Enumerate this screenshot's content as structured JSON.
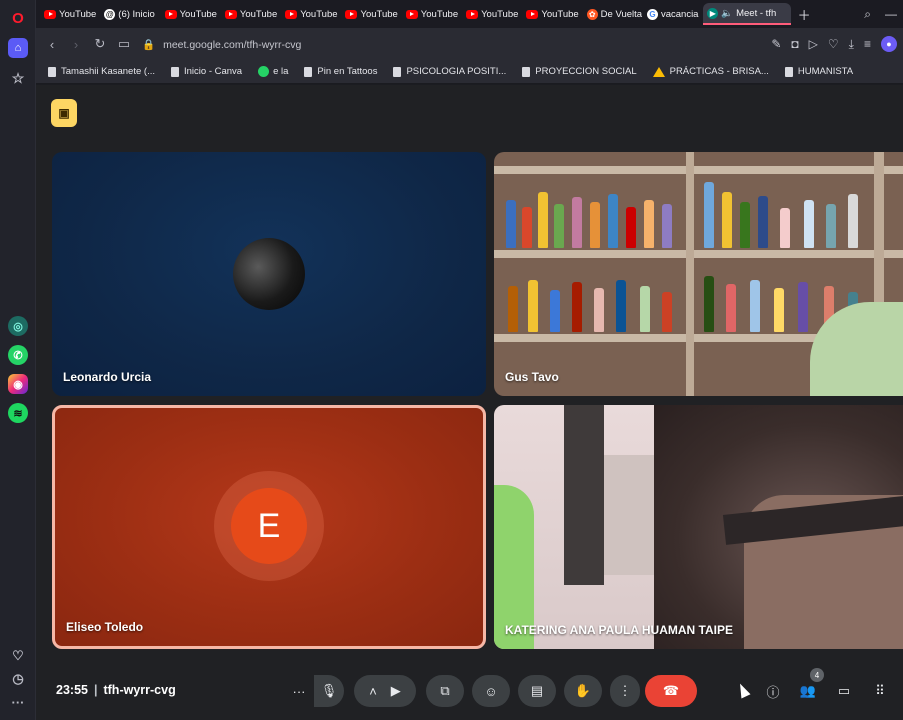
{
  "browser": {
    "tabs": [
      {
        "label": "YouTube",
        "icon": "youtube-icon"
      },
      {
        "label": "(6) Inicio",
        "icon": "threads-icon"
      },
      {
        "label": "YouTube",
        "icon": "youtube-icon"
      },
      {
        "label": "YouTube",
        "icon": "youtube-icon"
      },
      {
        "label": "YouTube",
        "icon": "youtube-icon"
      },
      {
        "label": "YouTube",
        "icon": "youtube-icon"
      },
      {
        "label": "YouTube",
        "icon": "youtube-icon"
      },
      {
        "label": "YouTube",
        "icon": "youtube-icon"
      },
      {
        "label": "YouTube",
        "icon": "youtube-icon"
      },
      {
        "label": "De Vuelta",
        "icon": "devuelta-icon"
      },
      {
        "label": "vacancia",
        "icon": "google-icon"
      },
      {
        "label": "Meet - tfh",
        "icon": "meet-icon"
      }
    ],
    "url": "meet.google.com/tfh-wyrr-cvg"
  },
  "bookmarks": [
    {
      "label": "Tamashii Kasanete (...",
      "icon": "page-icon"
    },
    {
      "label": "Inicio - Canva",
      "icon": "page-icon"
    },
    {
      "label": "e la",
      "icon": "whatsapp-icon"
    },
    {
      "label": "Pin en Tattoos",
      "icon": "page-icon"
    },
    {
      "label": "PSICOLOGIA POSITI...",
      "icon": "page-icon"
    },
    {
      "label": "PROYECCION SOCIAL",
      "icon": "page-icon"
    },
    {
      "label": "PRÁCTICAS - BRISA...",
      "icon": "drive-icon"
    },
    {
      "label": "HUMANISTA",
      "icon": "page-icon"
    }
  ],
  "meet": {
    "participants": [
      {
        "name": "Leonardo Urcia"
      },
      {
        "name": "Gus Tavo"
      },
      {
        "name": "Eliseo Toledo",
        "initial": "E"
      },
      {
        "name": "KATERING ANA PAULA HUAMAN TAIPE"
      }
    ],
    "controls": {
      "time": "23:55",
      "separator": "|",
      "meeting_code": "tfh-wyrr-cvg",
      "people_count": "4"
    }
  },
  "colors": {
    "meet_background": "#202124",
    "hangup_red": "#ea4335",
    "avatar_orange": "#e64a19",
    "speaking_border": "#f6b7a6"
  }
}
